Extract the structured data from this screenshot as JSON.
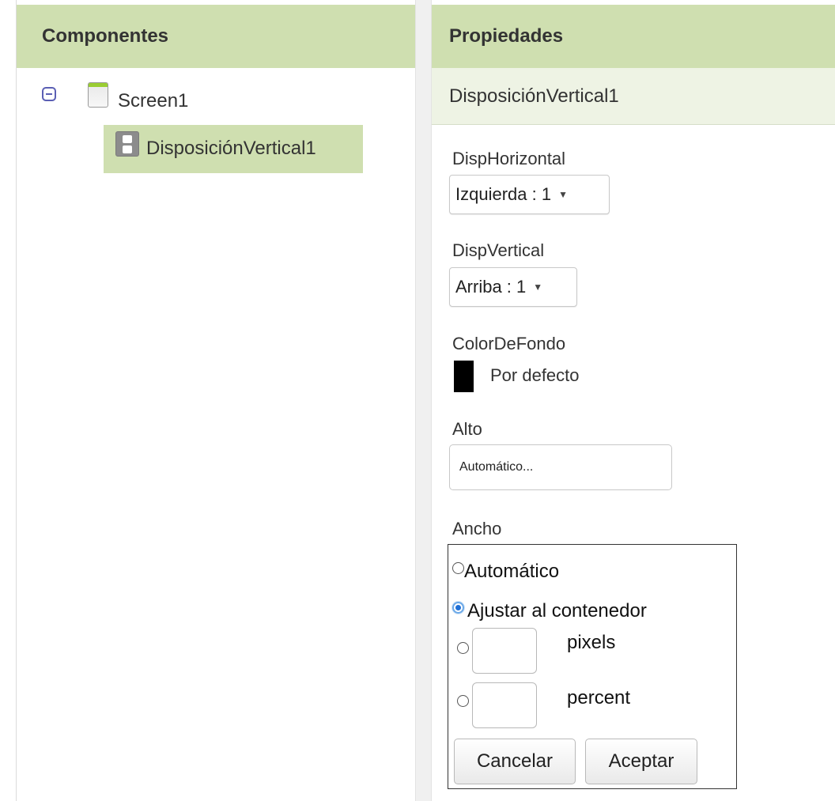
{
  "components_panel": {
    "header": "Componentes",
    "tree": {
      "root": {
        "label": "Screen1",
        "icon": "screen-icon",
        "expanded": true
      },
      "children": [
        {
          "label": "DisposiciónVertical1",
          "icon": "vertical-arrangement-icon",
          "selected": true
        }
      ]
    }
  },
  "properties_panel": {
    "header": "Propiedades",
    "component_name": "DisposiciónVertical1",
    "properties": {
      "horizontal_align": {
        "label": "DispHorizontal",
        "value": "Izquierda : 1"
      },
      "vertical_align": {
        "label": "DispVertical",
        "value": "Arriba : 1"
      },
      "background_color": {
        "label": "ColorDeFondo",
        "value": "Por defecto",
        "swatch_color": "#000000"
      },
      "height": {
        "label": "Alto",
        "value": "Automático..."
      },
      "width": {
        "label": "Ancho",
        "options": [
          {
            "label": "Automático",
            "checked": false
          },
          {
            "label": "Ajustar al contenedor",
            "checked": true
          },
          {
            "label": "pixels",
            "checked": false,
            "input_value": ""
          },
          {
            "label": "percent",
            "checked": false,
            "input_value": ""
          }
        ],
        "cancel_label": "Cancelar",
        "ok_label": "Aceptar"
      }
    }
  },
  "colors": {
    "header_bg": "#cfdfb0",
    "selected_bg": "#cfdfb0",
    "radio_checked": "#1e6fd6"
  }
}
